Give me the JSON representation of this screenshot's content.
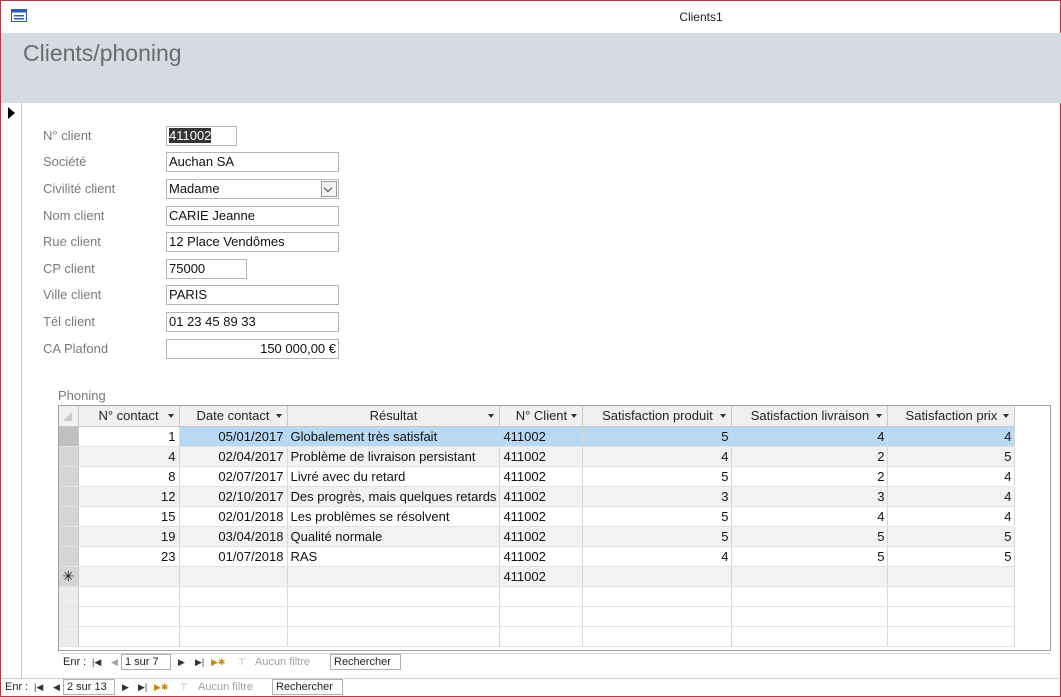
{
  "window": {
    "title": "Clients1"
  },
  "form": {
    "title": "Clients/phoning",
    "fields": [
      {
        "label": "N° client",
        "value": "411002"
      },
      {
        "label": "Société",
        "value": "Auchan SA"
      },
      {
        "label": "Civilité client",
        "value": "Madame"
      },
      {
        "label": "Nom client",
        "value": "CARIE Jeanne"
      },
      {
        "label": "Rue client",
        "value": "12 Place Vendômes"
      },
      {
        "label": "CP client",
        "value": "75000"
      },
      {
        "label": "Ville client",
        "value": "PARIS"
      },
      {
        "label": "Tél client",
        "value": "01 23 45 89 33"
      },
      {
        "label": "CA Plafond",
        "value": "150 000,00 €"
      }
    ]
  },
  "subform": {
    "label": "Phoning",
    "columns": [
      "N° contact",
      "Date contact",
      "Résultat",
      "N° Client",
      "Satisfaction produit",
      "Satisfaction livraison",
      "Satisfaction prix"
    ],
    "rows": [
      [
        "1",
        "05/01/2017",
        "Globalement très satisfait",
        "411002",
        "5",
        "4",
        "4"
      ],
      [
        "4",
        "02/04/2017",
        "Problème de livraison persistant",
        "411002",
        "4",
        "2",
        "5"
      ],
      [
        "8",
        "02/07/2017",
        "Livré avec du retard",
        "411002",
        "5",
        "2",
        "4"
      ],
      [
        "12",
        "02/10/2017",
        "Des progrès, mais quelques retards",
        "411002",
        "3",
        "3",
        "4"
      ],
      [
        "15",
        "02/01/2018",
        "Les problèmes se résolvent",
        "411002",
        "5",
        "4",
        "4"
      ],
      [
        "19",
        "03/04/2018",
        "Qualité normale",
        "411002",
        "5",
        "5",
        "5"
      ],
      [
        "23",
        "01/07/2018",
        "RAS",
        "411002",
        "4",
        "5",
        "5"
      ]
    ],
    "new_row_client": "411002",
    "new_row_marker": "✳",
    "nav": {
      "label": "Enr :",
      "position": "1 sur 7",
      "filter": "Aucun filtre",
      "search": "Rechercher"
    }
  },
  "main_nav": {
    "label": "Enr :",
    "position": "2 sur 13",
    "filter": "Aucun filtre",
    "search": "Rechercher"
  }
}
